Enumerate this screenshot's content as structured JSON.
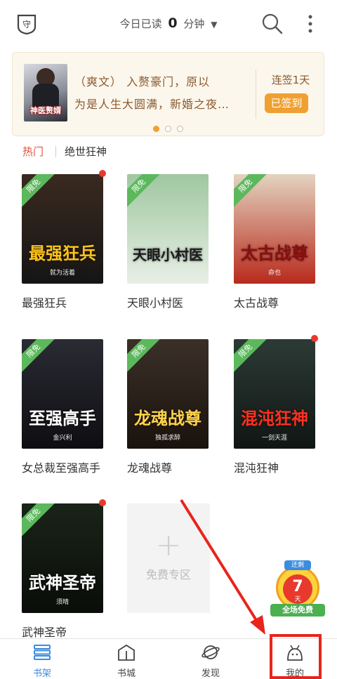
{
  "topbar": {
    "read_prefix": "今日已读",
    "read_minutes": "0",
    "read_unit": "分钟"
  },
  "banner": {
    "cover_title": "神医赘婿",
    "text_line1": "（爽文） 入赘豪门，原以",
    "text_line2": "为是人生大圆满，新婚之夜…",
    "streak_label": "连签1天",
    "checkin_label": "已签到",
    "pages": 3,
    "active_page": 1
  },
  "hot": {
    "label": "热门",
    "featured": "绝世狂神"
  },
  "books": [
    {
      "title": "最强狂兵",
      "cover_text": "最强狂兵",
      "author": "就为活着",
      "free_tag": "限免",
      "has_update": true,
      "colors": [
        "#3a2a20",
        "#151515"
      ],
      "title_color": "#ffc21a"
    },
    {
      "title": "天眼小村医",
      "cover_text": "天眼小村医",
      "author": "",
      "free_tag": "限免",
      "has_update": false,
      "colors": [
        "#9fc7a0",
        "#e8efe6"
      ],
      "title_color": "#1a1a1a"
    },
    {
      "title": "太古战尊",
      "cover_text": "太古战尊",
      "author": "命也",
      "free_tag": "限免",
      "has_update": false,
      "colors": [
        "#e3d4c0",
        "#b82a1c"
      ],
      "title_color": "#8a0d0d"
    },
    {
      "title": "女总裁至强高手",
      "cover_text": "至强高手",
      "author": "金兴利",
      "free_tag": "限免",
      "has_update": false,
      "colors": [
        "#2a2b33",
        "#0e0e12"
      ],
      "title_color": "#ffffff"
    },
    {
      "title": "龙魂战尊",
      "cover_text": "龙魂战尊",
      "author": "独孤求醉",
      "free_tag": "限免",
      "has_update": false,
      "colors": [
        "#3a3028",
        "#1a120c"
      ],
      "title_color": "#ffd34a"
    },
    {
      "title": "混沌狂神",
      "cover_text": "混沌狂神",
      "author": "一剑天涯",
      "free_tag": "限免",
      "has_update": true,
      "colors": [
        "#2c3a36",
        "#101614"
      ],
      "title_color": "#ff3020"
    },
    {
      "title": "武神圣帝",
      "cover_text": "武神圣帝",
      "author": "须晴",
      "free_tag": "限免",
      "has_update": true,
      "colors": [
        "#1a2418",
        "#0a0d09"
      ],
      "title_color": "#ffffff"
    }
  ],
  "free_zone": {
    "plus": "+",
    "label": "免费专区"
  },
  "promo": {
    "top_label": "还剩",
    "number": "7",
    "days_label": "天",
    "bottom_label": "全场免费"
  },
  "nav": [
    {
      "label": "书架",
      "icon": "bookshelf-icon",
      "active": true
    },
    {
      "label": "书城",
      "icon": "bookstore-icon",
      "active": false
    },
    {
      "label": "发现",
      "icon": "planet-icon",
      "active": false
    },
    {
      "label": "我的",
      "icon": "profile-icon",
      "active": false
    }
  ],
  "colors": {
    "accent": "#3a8de0",
    "hot": "#e05040",
    "checkin": "#f0a030",
    "annotation": "#e8241c"
  }
}
